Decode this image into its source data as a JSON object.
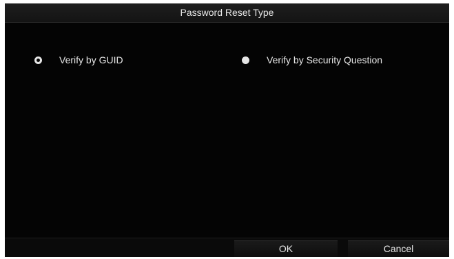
{
  "dialog": {
    "title": "Password Reset Type",
    "options": [
      {
        "label": "Verify by GUID",
        "selected": true
      },
      {
        "label": "Verify by Security Question",
        "selected": false
      }
    ],
    "buttons": {
      "ok_label": "OK",
      "cancel_label": "Cancel"
    }
  },
  "colors": {
    "background": "#050505",
    "text": "#e6e6e6"
  }
}
